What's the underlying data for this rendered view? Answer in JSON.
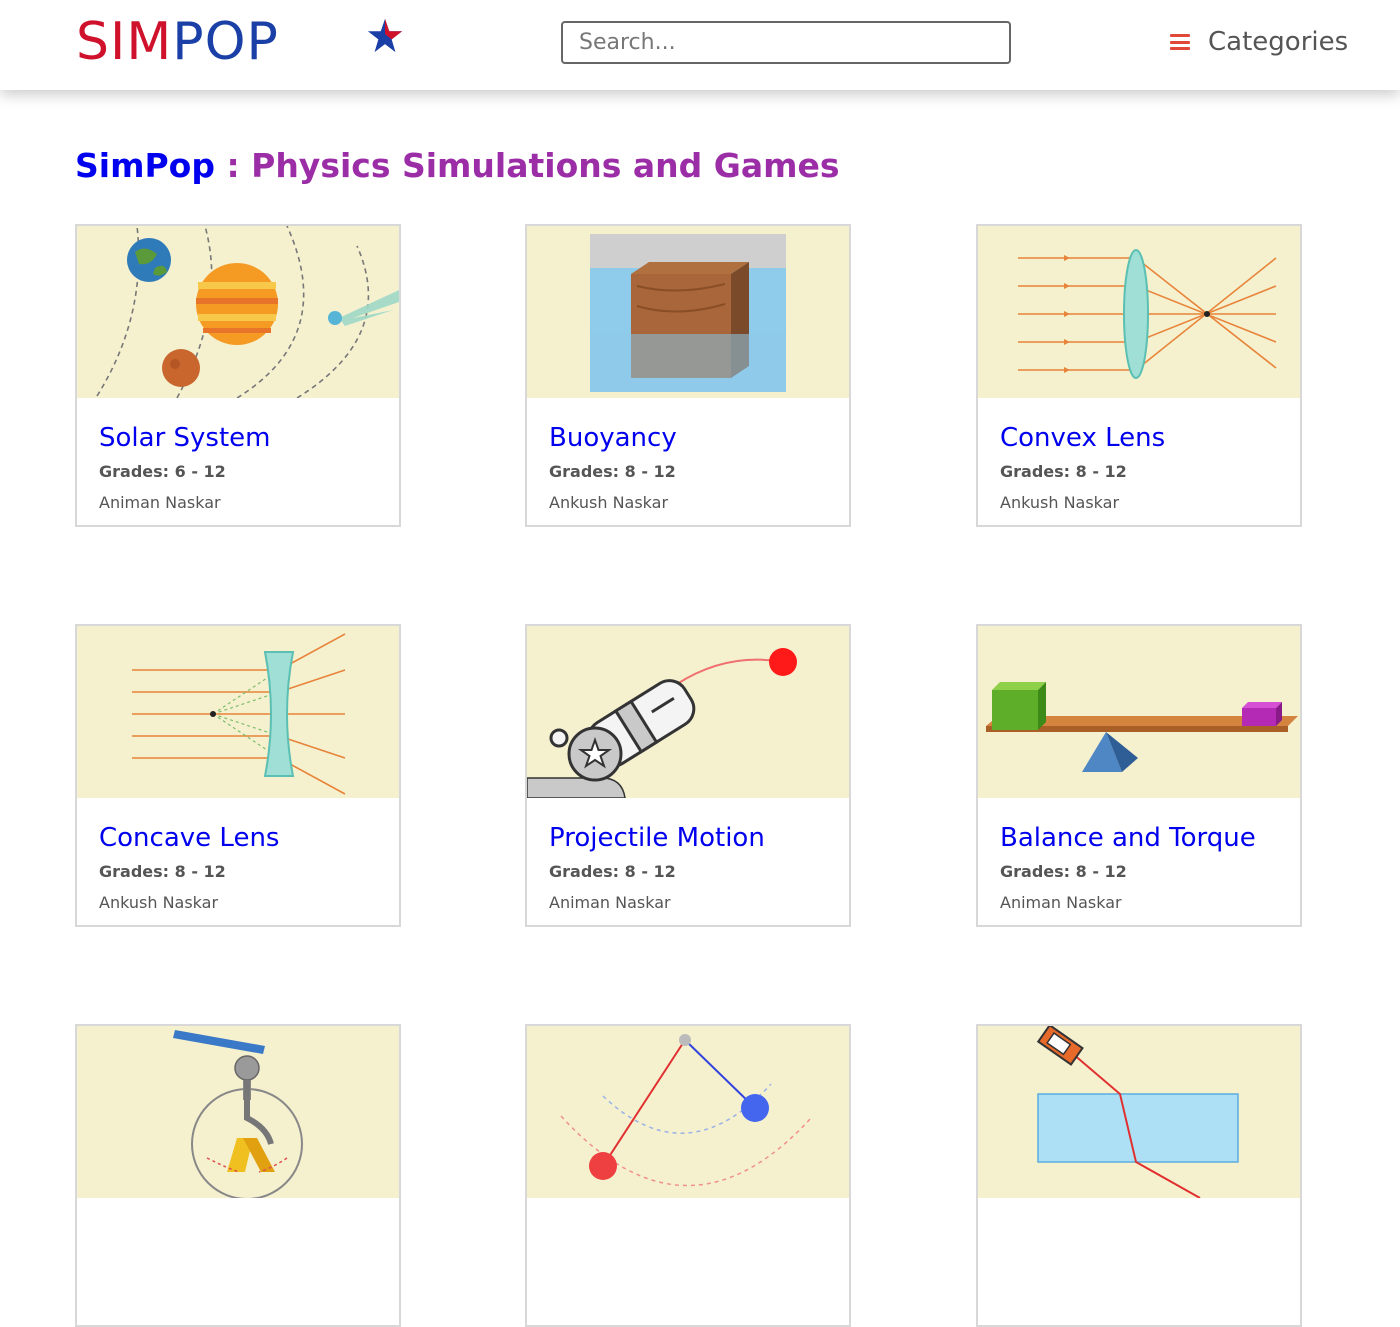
{
  "header": {
    "logo": {
      "part1": "SIM",
      "part2": "POP"
    },
    "search": {
      "placeholder": "Search..."
    },
    "categories_label": "Categories"
  },
  "page": {
    "title_brand": "SimPop",
    "title_rest": " : Physics Simulations and Games"
  },
  "colors": {
    "link_blue": "#0000ee",
    "title_purple": "#9b2da6",
    "logo_red": "#d0112b",
    "logo_blue": "#1a3fa6",
    "thumb_bg": "#f5f1cf",
    "menu_accent": "#e0483a"
  },
  "cards": [
    {
      "title": "Solar System",
      "grades": "Grades: 6 - 12",
      "author": "Animan Naskar",
      "thumbnail_icon": "solar-system-icon"
    },
    {
      "title": "Buoyancy",
      "grades": "Grades: 8 - 12",
      "author": "Ankush Naskar",
      "thumbnail_icon": "buoyancy-icon"
    },
    {
      "title": "Convex Lens",
      "grades": "Grades: 8 - 12",
      "author": "Ankush Naskar",
      "thumbnail_icon": "convex-lens-icon"
    },
    {
      "title": "Concave Lens",
      "grades": "Grades: 8 - 12",
      "author": "Ankush Naskar",
      "thumbnail_icon": "concave-lens-icon"
    },
    {
      "title": "Projectile Motion",
      "grades": "Grades: 8 - 12",
      "author": "Animan Naskar",
      "thumbnail_icon": "cannon-icon"
    },
    {
      "title": "Balance and Torque",
      "grades": "Grades: 8 - 12",
      "author": "Animan Naskar",
      "thumbnail_icon": "seesaw-icon"
    },
    {
      "thumbnail_icon": "electroscope-icon"
    },
    {
      "thumbnail_icon": "pendulum-icon"
    },
    {
      "thumbnail_icon": "refraction-icon"
    }
  ]
}
